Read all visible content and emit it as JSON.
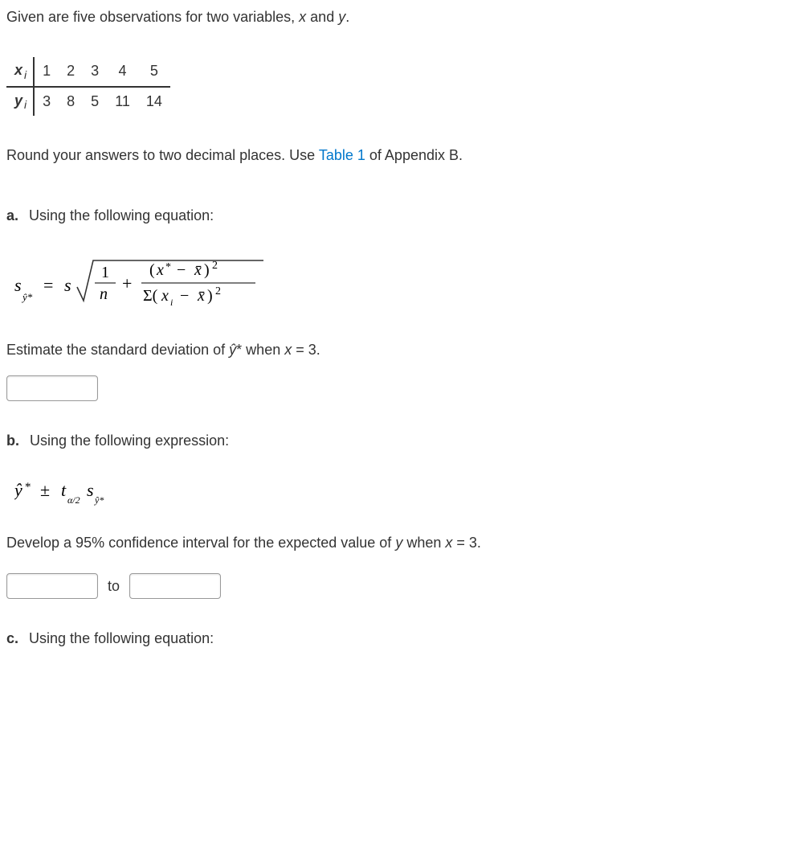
{
  "intro": {
    "given": "Given are five observations for two variables, ",
    "var1": "x",
    "and": " and ",
    "var2": "y",
    "period": "."
  },
  "table": {
    "row1_header": "x",
    "row2_header": "y",
    "sub": "i",
    "x_values": [
      "1",
      "2",
      "3",
      "4",
      "5"
    ],
    "y_values": [
      "3",
      "8",
      "5",
      "11",
      "14"
    ]
  },
  "instructions": {
    "round": "Round your answers to two decimal places. Use ",
    "link_text": "Table 1",
    "appendix": " of Appendix B."
  },
  "part_a": {
    "label": "a.",
    "prompt": "Using the following equation:",
    "equation_desc": "s_ŷ* = s · sqrt( 1/n + (x* − x̄)² / Σ(xᵢ − x̄)² )",
    "question_pre": "Estimate the standard deviation of ",
    "question_sym": "ŷ",
    "question_post1": "* when ",
    "question_var": "x",
    "question_post2": " = 3."
  },
  "part_b": {
    "label": "b.",
    "prompt": "Using the following expression:",
    "equation_desc": "ŷ* ± t_(α/2) · s_ŷ*",
    "question_pre": "Develop a 95% confidence interval for the expected value of ",
    "question_var1": "y",
    "question_mid": " when ",
    "question_var2": "x",
    "question_post": " = 3.",
    "to_label": "to"
  },
  "part_c": {
    "label": "c.",
    "prompt": "Using the following equation:"
  }
}
